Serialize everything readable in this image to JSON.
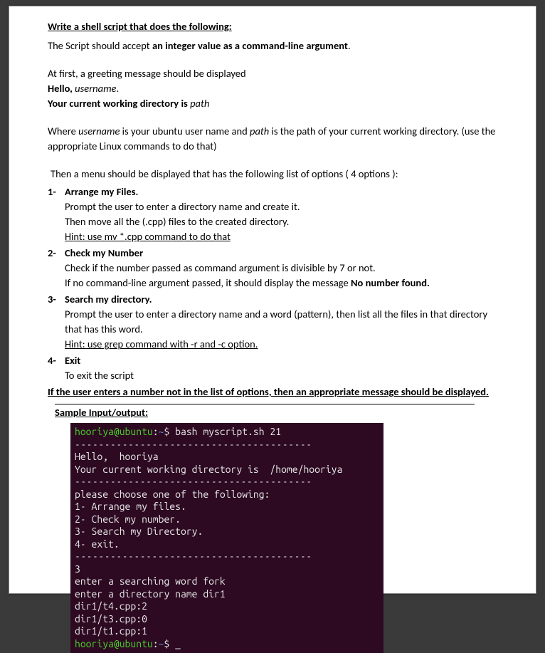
{
  "title": "Write a shell script that does the following:",
  "intro_prefix": "The Script should accept ",
  "intro_bold": "an integer value as a command-line argument",
  "intro_suffix": ".",
  "greet_intro": "At first, a greeting message should be displayed",
  "greet_hello_bold": "Hello, ",
  "greet_username": "username",
  "greet_hello_suffix": ".",
  "greet_cwd_bold": "Your current working directory is",
  "greet_path": " path",
  "where_prefix": "Where ",
  "where_user_it": "username",
  "where_mid": " is your ubuntu user name and ",
  "where_path_it": "path",
  "where_suffix": " is the path of your current working directory. (use the appropriate Linux commands to do that)",
  "menu_intro": "Then a menu should be displayed that has the following list of options ( 4 options ):",
  "options": [
    {
      "num": "1-",
      "title": "Arrange my Files.",
      "lines": [
        "Prompt the user to enter a directory name and create it.",
        "Then move all the (.cpp) files to the created directory."
      ],
      "hint": "Hint: use mv *.cpp  command to do that"
    },
    {
      "num": "2-",
      "title": "Check my Number",
      "lines": [
        "Check if the number passed as command argument is divisible by 7 or not."
      ],
      "bold_line_prefix": "If no command-line argument passed, it should display the message ",
      "bold_line_bold": "No number found."
    },
    {
      "num": "3-",
      "title": "Search my directory.",
      "lines": [
        "Prompt the user to enter a directory name and a word (pattern), then list all the files in that directory that has this word."
      ],
      "hint": "Hint: use grep command with -r and -c option."
    },
    {
      "num": "4-",
      "title": "Exit",
      "lines": [
        "To exit the script"
      ]
    }
  ],
  "warning": "If the user enters a number not in the list of options, then an appropriate message should be displayed.",
  "sample_label": "Sample Input/output:",
  "terminal": {
    "prompt_user": "hooriya@ubuntu",
    "prompt_sep": ":",
    "prompt_path": "~",
    "prompt_char": "$ ",
    "cmd1": "bash myscript.sh 21",
    "sep1": "----------------------------------------",
    "hello": "Hello,  hooriya",
    "cwd": "Your current working directory is  /home/hooriya",
    "sep2": "----------------------------------------",
    "choose": "please choose one of the following:",
    "opt1": "1- Arrange my files.",
    "opt2": "2- Check my number.",
    "opt3": "3- Search my Directory.",
    "opt4": "4- exit.",
    "sep3": "----------------------------------------",
    "input": "3",
    "l1": "enter a searching word fork",
    "l2": "enter a directory name dir1",
    "l3": "dir1/t4.cpp:2",
    "l4": "dir1/t3.cpp:0",
    "l5": "dir1/t1.cpp:1",
    "cursor": "_"
  }
}
